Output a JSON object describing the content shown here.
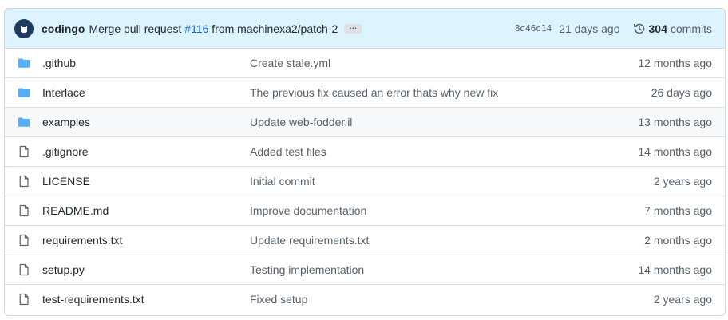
{
  "latest_commit": {
    "author": "codingo",
    "message_prefix": "Merge pull request",
    "pr_number": "#116",
    "message_suffix": "from machinexa2/patch-2",
    "ellipsis": "…",
    "sha": "8d46d14",
    "time_ago": "21 days ago",
    "commit_count": "304",
    "commits_label": "commits",
    "accent_color": "#ddf4ff",
    "link_color": "#0969da"
  },
  "files": [
    {
      "type": "folder",
      "name": ".github",
      "message": "Create stale.yml",
      "age": "12 months ago"
    },
    {
      "type": "folder",
      "name": "Interlace",
      "message": "The previous fix caused an error thats why new fix",
      "age": "26 days ago"
    },
    {
      "type": "folder",
      "name": "examples",
      "message": "Update web-fodder.il",
      "age": "13 months ago"
    },
    {
      "type": "file",
      "name": ".gitignore",
      "message": "Added test files",
      "age": "14 months ago"
    },
    {
      "type": "file",
      "name": "LICENSE",
      "message": "Initial commit",
      "age": "2 years ago"
    },
    {
      "type": "file",
      "name": "README.md",
      "message": "Improve documentation",
      "age": "7 months ago"
    },
    {
      "type": "file",
      "name": "requirements.txt",
      "message": "Update requirements.txt",
      "age": "2 months ago"
    },
    {
      "type": "file",
      "name": "setup.py",
      "message": "Testing implementation",
      "age": "14 months ago"
    },
    {
      "type": "file",
      "name": "test-requirements.txt",
      "message": "Fixed setup",
      "age": "2 years ago"
    }
  ],
  "icons": {
    "folder": "folder-icon",
    "file": "file-icon",
    "history": "history-icon",
    "avatar": "avatar-icon"
  },
  "folder_color": "#54aeff"
}
